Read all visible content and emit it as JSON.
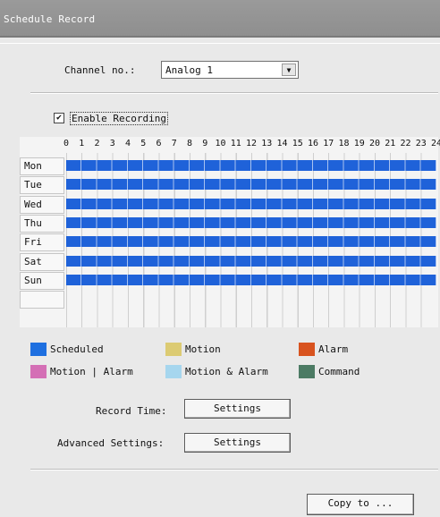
{
  "window": {
    "title": "Schedule Record"
  },
  "channel": {
    "label": "Channel no.:",
    "value": "Analog 1"
  },
  "enable_recording": {
    "label": "Enable Recording",
    "checked": true
  },
  "hours": [
    "0",
    "1",
    "2",
    "3",
    "4",
    "5",
    "6",
    "7",
    "8",
    "9",
    "10",
    "11",
    "12",
    "13",
    "14",
    "15",
    "16",
    "17",
    "18",
    "19",
    "20",
    "21",
    "22",
    "23",
    "24"
  ],
  "days": [
    "Mon",
    "Tue",
    "Wed",
    "Thu",
    "Fri",
    "Sat",
    "Sun"
  ],
  "legend": [
    {
      "label": "Scheduled",
      "color": "#1e6fe0"
    },
    {
      "label": "Motion",
      "color": "#dccb73"
    },
    {
      "label": "Alarm",
      "color": "#d8531f"
    },
    {
      "label": "Motion | Alarm",
      "color": "#d46fb5"
    },
    {
      "label": "Motion & Alarm",
      "color": "#a6d6ee"
    },
    {
      "label": "Command",
      "color": "#4c7b64"
    }
  ],
  "record_time": {
    "label": "Record Time:",
    "button": "Settings"
  },
  "advanced": {
    "label": "Advanced Settings:",
    "button": "Settings"
  },
  "copy_button": "Copy to ..."
}
